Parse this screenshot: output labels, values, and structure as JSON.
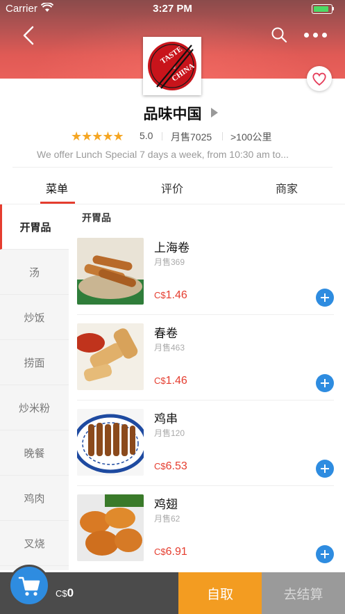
{
  "status_bar": {
    "carrier": "Carrier",
    "time": "3:27 PM",
    "battery_color": "#4cd964"
  },
  "header": {
    "back_icon": "chevron-left-icon",
    "search_icon": "search-icon",
    "more_icon": "more-dots-icon",
    "favorite_icon": "heart-icon",
    "logo_text_top": "TASTE",
    "logo_text_of": "of",
    "logo_text_bottom": "CHINA"
  },
  "store": {
    "name": "品味中国",
    "stars": "★★★★★",
    "rating": "5.0",
    "monthly_sales": "月售7025",
    "distance": ">100公里",
    "announcement": "We offer Lunch Special 7 days a week, from 10:30 am to..."
  },
  "tabs": [
    {
      "label": "菜单",
      "active": true
    },
    {
      "label": "评价",
      "active": false
    },
    {
      "label": "商家",
      "active": false
    }
  ],
  "categories": [
    {
      "label": "开胃品",
      "active": true
    },
    {
      "label": "汤"
    },
    {
      "label": "炒饭"
    },
    {
      "label": "捞面"
    },
    {
      "label": "炒米粉"
    },
    {
      "label": "晚餐"
    },
    {
      "label": "鸡肉"
    },
    {
      "label": "叉烧"
    }
  ],
  "section_title": "开胃品",
  "items": [
    {
      "name": "上海卷",
      "sales": "月售369",
      "currency": "C$",
      "price": "1.46"
    },
    {
      "name": "春卷",
      "sales": "月售463",
      "currency": "C$",
      "price": "1.46"
    },
    {
      "name": "鸡串",
      "sales": "月售120",
      "currency": "C$",
      "price": "6.53"
    },
    {
      "name": "鸡翅",
      "sales": "月售62",
      "currency": "C$",
      "price": "6.91"
    }
  ],
  "cart": {
    "icon": "shopping-cart-icon",
    "currency": "C$",
    "total": "0",
    "pickup_label": "自取",
    "checkout_label": "去结算"
  },
  "colors": {
    "accent_red": "#e53d2f",
    "accent_blue": "#2e8ce0",
    "pickup_orange": "#f39c21",
    "star_gold": "#f5a623"
  }
}
